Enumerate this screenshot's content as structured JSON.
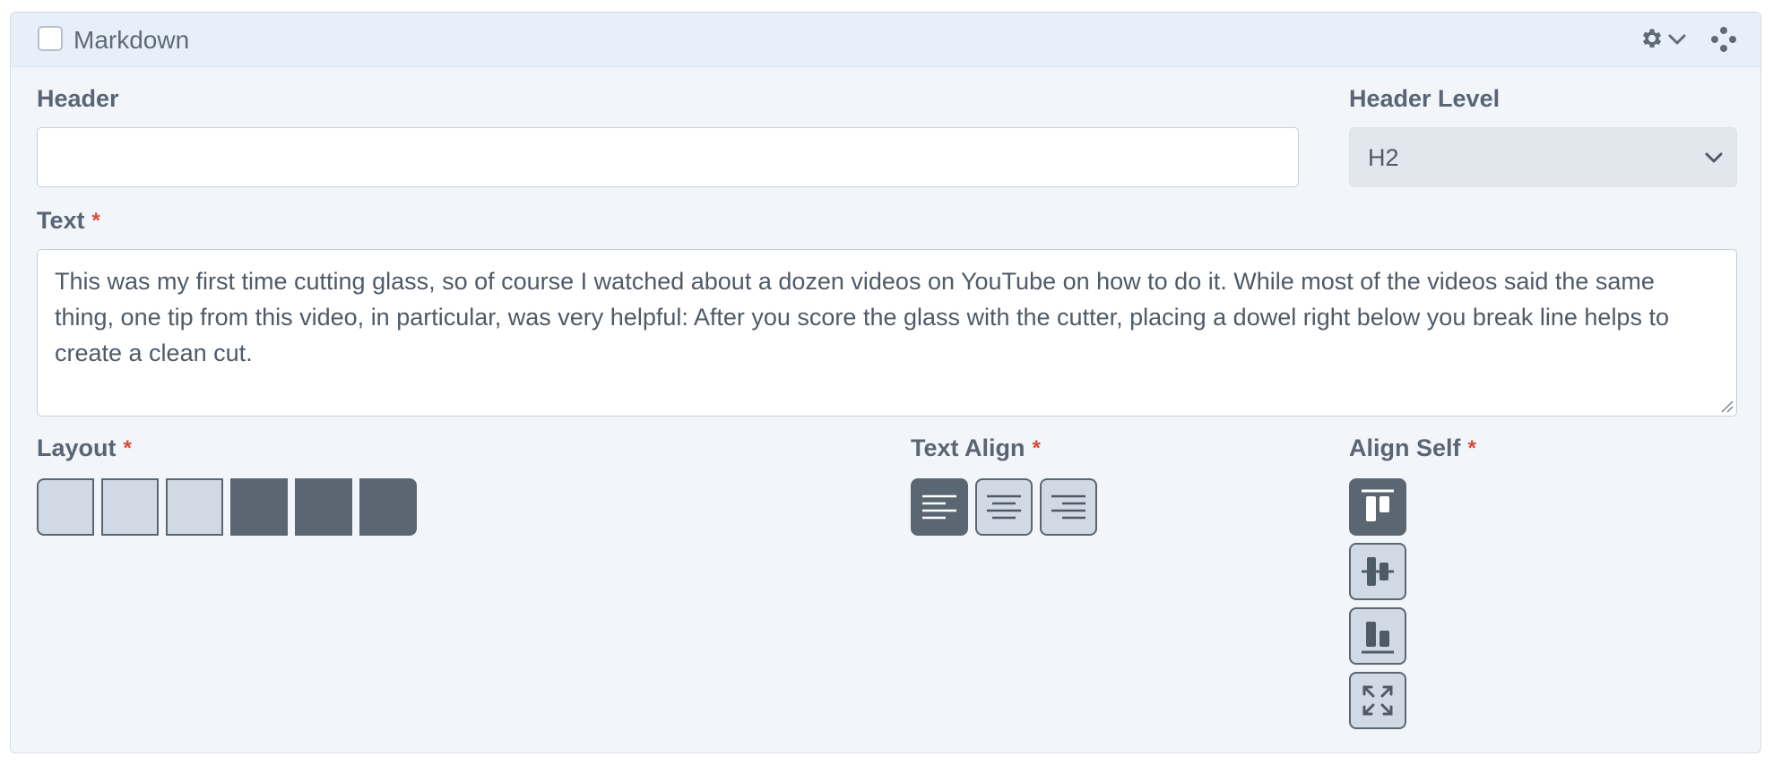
{
  "block": {
    "title": "Markdown",
    "checked": false
  },
  "icons": {
    "settings": "gear-icon",
    "settings_caret": "chevron-down-icon",
    "drag": "drag-handle-icon"
  },
  "fields": {
    "header": {
      "label": "Header",
      "value": ""
    },
    "header_level": {
      "label": "Header Level",
      "selected": "H2"
    },
    "text": {
      "label": "Text",
      "required_mark": "*",
      "value": "This was my first time cutting glass, so of course I watched about a dozen videos on YouTube on how to do it. While most of the videos said the same thing, one tip from this video, in particular, was very helpful: After you score the glass with the cutter, placing a dowel right below you break line helps to create a clean cut."
    },
    "layout": {
      "label": "Layout",
      "required_mark": "*",
      "columns_total": 6,
      "columns_selected": 3
    },
    "text_align": {
      "label": "Text Align",
      "required_mark": "*",
      "options": [
        "left",
        "center",
        "right"
      ],
      "selected": "left"
    },
    "align_self": {
      "label": "Align Self",
      "required_mark": "*",
      "options": [
        "start",
        "center",
        "end",
        "stretch"
      ],
      "selected": "start"
    }
  },
  "colors": {
    "panel_bg": "#f2f6fb",
    "header_bg": "#e7eff8",
    "active_button": "#5b6673",
    "inactive_button": "#d1d9e4",
    "required": "#d64a3a"
  }
}
